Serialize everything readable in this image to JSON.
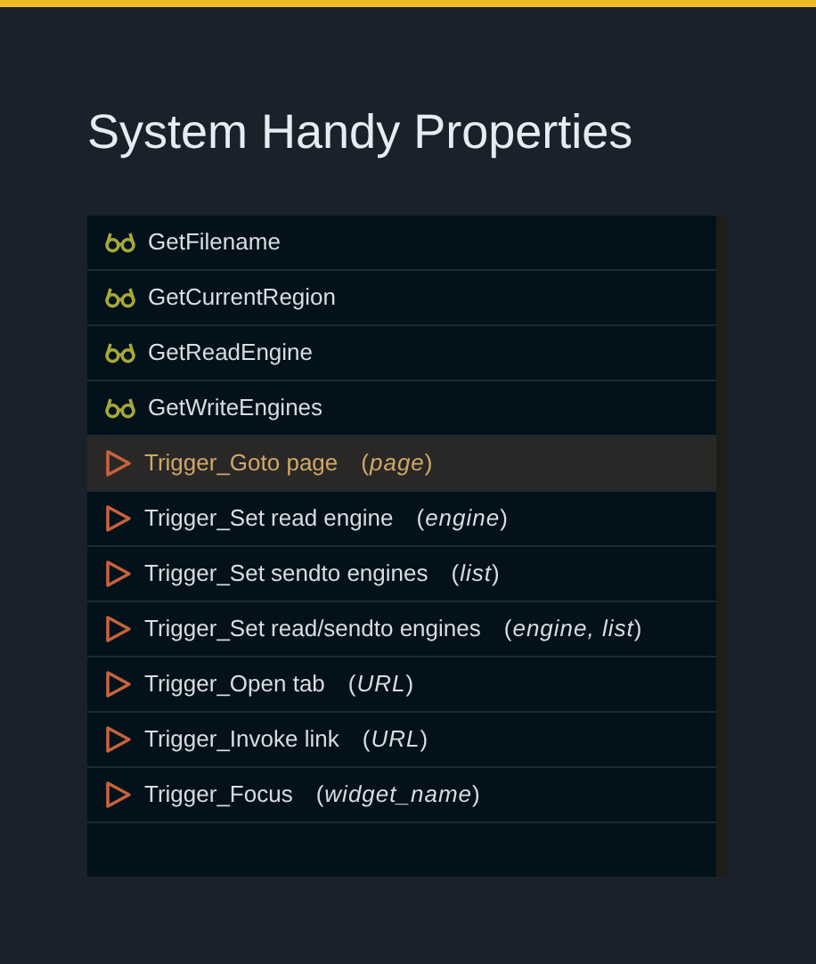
{
  "title": "System Handy Properties",
  "items": [
    {
      "kind": "getter",
      "label": "GetFilename",
      "selected": false
    },
    {
      "kind": "getter",
      "label": "GetCurrentRegion",
      "selected": false
    },
    {
      "kind": "getter",
      "label": "GetReadEngine",
      "selected": false
    },
    {
      "kind": "getter",
      "label": "GetWriteEngines",
      "selected": false
    },
    {
      "kind": "trigger",
      "label": "Trigger_Goto page",
      "args": "(*page*)",
      "selected": true
    },
    {
      "kind": "trigger",
      "label": "Trigger_Set read engine",
      "args": "(*engine*)",
      "selected": false
    },
    {
      "kind": "trigger",
      "label": "Trigger_Set sendto engines",
      "args": "(*list*)",
      "selected": false
    },
    {
      "kind": "trigger",
      "label": "Trigger_Set read/sendto engines",
      "args": "(*engine, list*)",
      "selected": false
    },
    {
      "kind": "trigger",
      "label": "Trigger_Open tab",
      "args": "(*URL*)",
      "selected": false
    },
    {
      "kind": "trigger",
      "label": "Trigger_Invoke link",
      "args": "(*URL*)",
      "selected": false
    },
    {
      "kind": "trigger",
      "label": "Trigger_Focus",
      "args": "(*widget_name*)",
      "selected": false
    }
  ]
}
